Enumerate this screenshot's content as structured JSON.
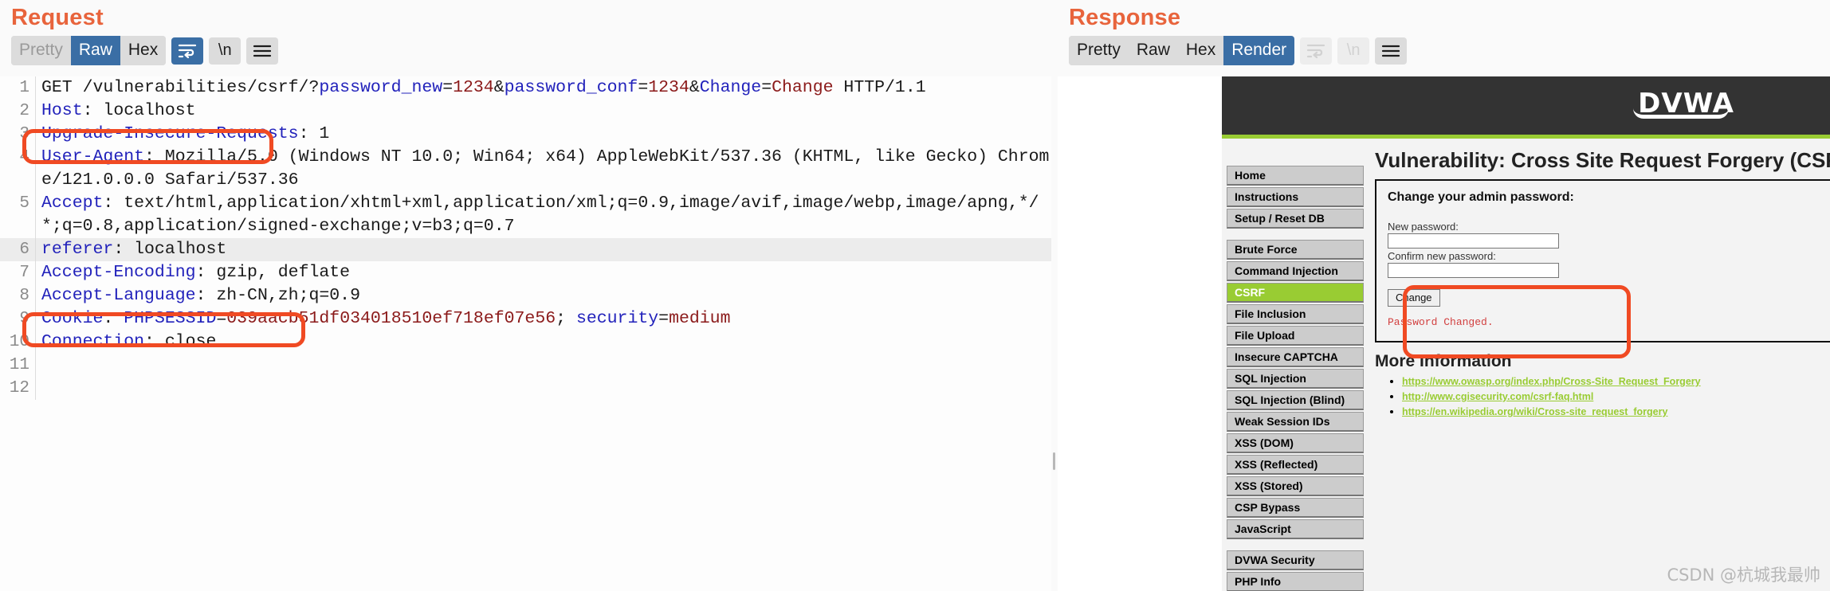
{
  "request": {
    "title": "Request",
    "toolbar": {
      "tabs": [
        {
          "label": "Pretty",
          "state": "muted"
        },
        {
          "label": "Raw",
          "state": "active"
        },
        {
          "label": "Hex",
          "state": "normal"
        }
      ],
      "icons": [
        {
          "name": "word-wrap-icon",
          "glyph": "wrap",
          "state": "active"
        },
        {
          "name": "newline-icon",
          "glyph": "\\n",
          "state": "normal"
        },
        {
          "name": "hamburger-menu-icon",
          "glyph": "menu",
          "state": "normal"
        }
      ]
    },
    "lines": [
      {
        "num": "1",
        "highlight": false,
        "parts": [
          {
            "t": "GET /vulnerabilities/csrf/?",
            "c": "txt"
          },
          {
            "t": "password_new",
            "c": "hdr"
          },
          {
            "t": "=",
            "c": "txt"
          },
          {
            "t": "1234",
            "c": "val"
          },
          {
            "t": "&",
            "c": "txt"
          },
          {
            "t": "password_conf",
            "c": "hdr"
          },
          {
            "t": "=",
            "c": "txt"
          },
          {
            "t": "1234",
            "c": "val"
          },
          {
            "t": "&",
            "c": "txt"
          },
          {
            "t": "Change",
            "c": "hdr"
          },
          {
            "t": "=",
            "c": "txt"
          },
          {
            "t": "Change",
            "c": "val"
          },
          {
            "t": " HTTP/1.1",
            "c": "txt"
          }
        ]
      },
      {
        "num": "2",
        "highlight": false,
        "parts": [
          {
            "t": "Host",
            "c": "hdr"
          },
          {
            "t": ": localhost",
            "c": "txt"
          }
        ]
      },
      {
        "num": "3",
        "highlight": false,
        "parts": [
          {
            "t": "Upgrade-Insecure-Requests",
            "c": "hdr"
          },
          {
            "t": ": 1",
            "c": "txt"
          }
        ]
      },
      {
        "num": "4",
        "highlight": false,
        "parts": [
          {
            "t": "User-Agent",
            "c": "hdr"
          },
          {
            "t": ": Mozilla/5.0 (Windows NT 10.0; Win64; x64) AppleWebKit/537.36 (KHTML, like Gecko) Chrome/121.0.0.0 Safari/537.36",
            "c": "txt"
          }
        ]
      },
      {
        "num": "5",
        "highlight": false,
        "parts": [
          {
            "t": "Accept",
            "c": "hdr"
          },
          {
            "t": ": text/html,application/xhtml+xml,application/xml;q=0.9,image/avif,image/webp,image/apng,*/*;q=0.8,application/signed-exchange;v=b3;q=0.7",
            "c": "txt"
          }
        ]
      },
      {
        "num": "6",
        "highlight": true,
        "parts": [
          {
            "t": "referer",
            "c": "hdr"
          },
          {
            "t": ": localhost",
            "c": "txt"
          }
        ]
      },
      {
        "num": "7",
        "highlight": false,
        "parts": [
          {
            "t": "Accept-Encoding",
            "c": "hdr"
          },
          {
            "t": ": gzip, deflate",
            "c": "txt"
          }
        ]
      },
      {
        "num": "8",
        "highlight": false,
        "parts": [
          {
            "t": "Accept-Language",
            "c": "hdr"
          },
          {
            "t": ": zh-CN,zh;q=0.9",
            "c": "txt"
          }
        ]
      },
      {
        "num": "9",
        "highlight": false,
        "parts": [
          {
            "t": "Cookie",
            "c": "hdr"
          },
          {
            "t": ": ",
            "c": "txt"
          },
          {
            "t": "PHPSESSID",
            "c": "hdr"
          },
          {
            "t": "=",
            "c": "txt"
          },
          {
            "t": "039aacb51df034018510ef718ef07e56",
            "c": "val"
          },
          {
            "t": "; ",
            "c": "txt"
          },
          {
            "t": "security",
            "c": "hdr"
          },
          {
            "t": "=",
            "c": "txt"
          },
          {
            "t": "medium",
            "c": "val"
          }
        ]
      },
      {
        "num": "10",
        "highlight": false,
        "parts": [
          {
            "t": "Connection",
            "c": "hdr"
          },
          {
            "t": ": close",
            "c": "txt"
          }
        ]
      },
      {
        "num": "11",
        "highlight": false,
        "parts": []
      },
      {
        "num": "12",
        "highlight": false,
        "parts": []
      }
    ]
  },
  "response": {
    "title": "Response",
    "toolbar": {
      "tabs": [
        {
          "label": "Pretty",
          "state": "normal"
        },
        {
          "label": "Raw",
          "state": "normal"
        },
        {
          "label": "Hex",
          "state": "normal"
        },
        {
          "label": "Render",
          "state": "active"
        }
      ],
      "icons": [
        {
          "name": "word-wrap-icon",
          "glyph": "wrap",
          "state": "disabled"
        },
        {
          "name": "newline-icon",
          "glyph": "\\n",
          "state": "disabled"
        },
        {
          "name": "hamburger-menu-icon",
          "glyph": "menu",
          "state": "normal"
        }
      ]
    },
    "dvwa": {
      "logo": "DVWA",
      "nav_groups": [
        {
          "items": [
            {
              "label": "Home",
              "selected": false
            },
            {
              "label": "Instructions",
              "selected": false
            },
            {
              "label": "Setup / Reset DB",
              "selected": false
            }
          ]
        },
        {
          "items": [
            {
              "label": "Brute Force",
              "selected": false
            },
            {
              "label": "Command Injection",
              "selected": false
            },
            {
              "label": "CSRF",
              "selected": true
            },
            {
              "label": "File Inclusion",
              "selected": false
            },
            {
              "label": "File Upload",
              "selected": false
            },
            {
              "label": "Insecure CAPTCHA",
              "selected": false
            },
            {
              "label": "SQL Injection",
              "selected": false
            },
            {
              "label": "SQL Injection (Blind)",
              "selected": false
            },
            {
              "label": "Weak Session IDs",
              "selected": false
            },
            {
              "label": "XSS (DOM)",
              "selected": false
            },
            {
              "label": "XSS (Reflected)",
              "selected": false
            },
            {
              "label": "XSS (Stored)",
              "selected": false
            },
            {
              "label": "CSP Bypass",
              "selected": false
            },
            {
              "label": "JavaScript",
              "selected": false
            }
          ]
        },
        {
          "items": [
            {
              "label": "DVWA Security",
              "selected": false
            },
            {
              "label": "PHP Info",
              "selected": false
            }
          ]
        }
      ],
      "page_title": "Vulnerability: Cross Site Request Forgery (CSRF)",
      "form": {
        "heading": "Change your admin password:",
        "new_password_label": "New password:",
        "new_password_value": "",
        "confirm_password_label": "Confirm new password:",
        "confirm_password_value": "",
        "submit_label": "Change",
        "status_message": "Password Changed."
      },
      "more_information": {
        "heading": "More Information",
        "links": [
          "https://www.owasp.org/index.php/Cross-Site_Request_Forgery",
          "http://www.cgisecurity.com/csrf-faq.html",
          "https://en.wikipedia.org/wiki/Cross-site_request_forgery"
        ]
      }
    },
    "watermark": "CSDN @杭城我最帅"
  },
  "annotations": [
    {
      "name": "annot-host",
      "target": "Host: localhost"
    },
    {
      "name": "annot-referer",
      "target": "referer: localhost"
    },
    {
      "name": "annot-change",
      "target": "Change / Password Changed."
    }
  ],
  "colors": {
    "accent": "#e8643c",
    "active_tab": "#3a6ea5",
    "annotation": "#f04a23",
    "dvwa_green": "#99cc33",
    "status_red": "#d24040"
  }
}
